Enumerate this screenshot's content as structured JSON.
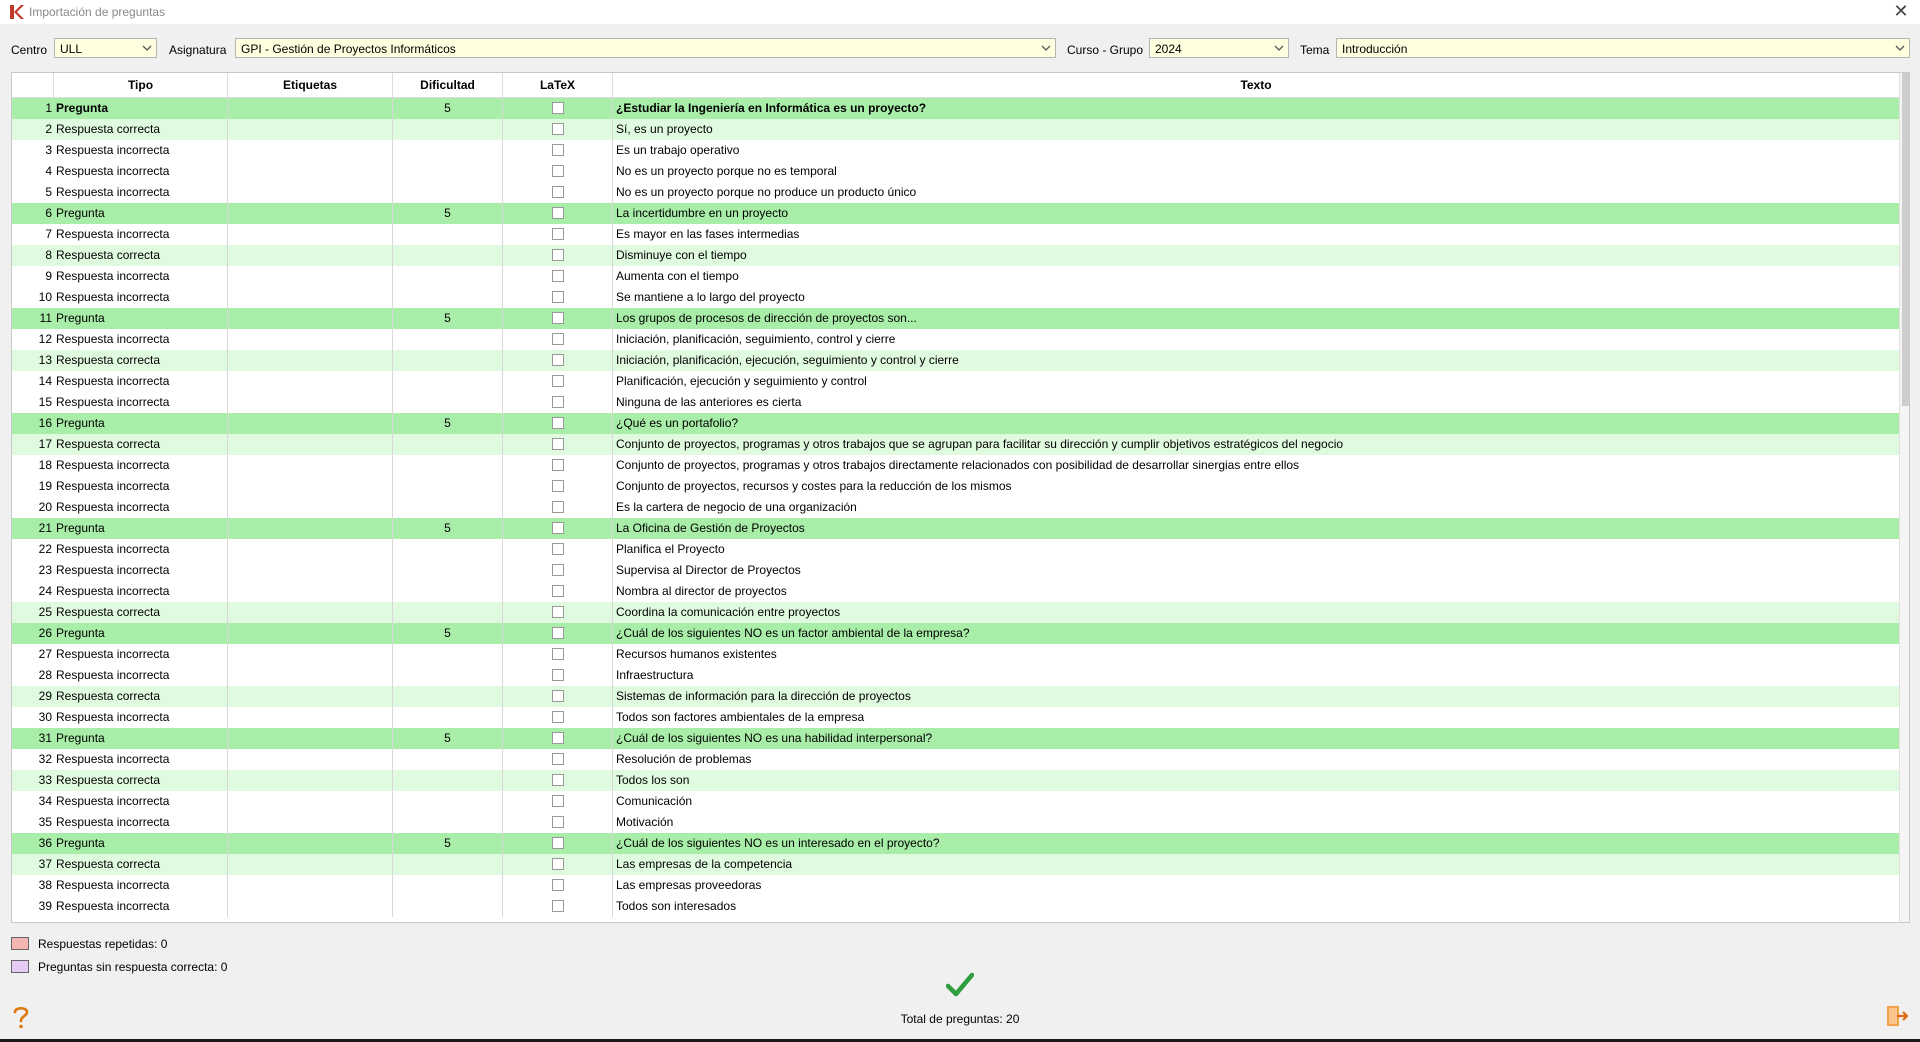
{
  "window": {
    "title": "Importación de preguntas"
  },
  "filters": {
    "centro_label": "Centro",
    "centro_value": "ULL",
    "asignatura_label": "Asignatura",
    "asignatura_value": "GPI - Gestión de Proyectos Informáticos",
    "curso_label": "Curso - Grupo",
    "curso_value": "2024",
    "tema_label": "Tema",
    "tema_value": "Introducción"
  },
  "table": {
    "headers": [
      "Tipo",
      "Etiquetas",
      "Dificultad",
      "LaTeX",
      "Texto"
    ],
    "rows": [
      {
        "n": "1",
        "tipo": "Pregunta",
        "dif": "5",
        "texto": "¿Estudiar la Ingeniería en Informática es un proyecto?",
        "kind": "q"
      },
      {
        "n": "2",
        "tipo": "Respuesta correcta",
        "dif": "",
        "texto": "Sí, es un proyecto",
        "kind": "rc"
      },
      {
        "n": "3",
        "tipo": "Respuesta incorrecta",
        "dif": "",
        "texto": "Es un trabajo operativo",
        "kind": "ri"
      },
      {
        "n": "4",
        "tipo": "Respuesta incorrecta",
        "dif": "",
        "texto": "No es un proyecto porque no es temporal",
        "kind": "ri"
      },
      {
        "n": "5",
        "tipo": "Respuesta incorrecta",
        "dif": "",
        "texto": "No es un proyecto porque no produce un producto único",
        "kind": "ri"
      },
      {
        "n": "6",
        "tipo": "Pregunta",
        "dif": "5",
        "texto": "La incertidumbre en un proyecto",
        "kind": "q"
      },
      {
        "n": "7",
        "tipo": "Respuesta incorrecta",
        "dif": "",
        "texto": "Es mayor en las fases intermedias",
        "kind": "ri"
      },
      {
        "n": "8",
        "tipo": "Respuesta correcta",
        "dif": "",
        "texto": "Disminuye con el tiempo",
        "kind": "rc"
      },
      {
        "n": "9",
        "tipo": "Respuesta incorrecta",
        "dif": "",
        "texto": "Aumenta con el tiempo",
        "kind": "ri"
      },
      {
        "n": "10",
        "tipo": "Respuesta incorrecta",
        "dif": "",
        "texto": "Se mantiene a lo largo del proyecto",
        "kind": "ri"
      },
      {
        "n": "11",
        "tipo": "Pregunta",
        "dif": "5",
        "texto": "Los grupos de procesos de dirección de proyectos son...",
        "kind": "q"
      },
      {
        "n": "12",
        "tipo": "Respuesta incorrecta",
        "dif": "",
        "texto": "Iniciación, planificación, seguimiento, control y cierre",
        "kind": "ri"
      },
      {
        "n": "13",
        "tipo": "Respuesta correcta",
        "dif": "",
        "texto": "Iniciación, planificación, ejecución, seguimiento y control y cierre",
        "kind": "rc"
      },
      {
        "n": "14",
        "tipo": "Respuesta incorrecta",
        "dif": "",
        "texto": "Planificación, ejecución y seguimiento y control",
        "kind": "ri"
      },
      {
        "n": "15",
        "tipo": "Respuesta incorrecta",
        "dif": "",
        "texto": "Ninguna de las anteriores es cierta",
        "kind": "ri"
      },
      {
        "n": "16",
        "tipo": "Pregunta",
        "dif": "5",
        "texto": "¿Qué es un portafolio?",
        "kind": "q"
      },
      {
        "n": "17",
        "tipo": "Respuesta correcta",
        "dif": "",
        "texto": "Conjunto de proyectos, programas y otros trabajos que se agrupan para facilitar su dirección y cumplir objetivos estratégicos del negocio",
        "kind": "rc"
      },
      {
        "n": "18",
        "tipo": "Respuesta incorrecta",
        "dif": "",
        "texto": "Conjunto de proyectos, programas y otros trabajos directamente relacionados con posibilidad de desarrollar sinergias entre ellos",
        "kind": "ri"
      },
      {
        "n": "19",
        "tipo": "Respuesta incorrecta",
        "dif": "",
        "texto": "Conjunto de proyectos, recursos y costes para la reducción de los mismos",
        "kind": "ri"
      },
      {
        "n": "20",
        "tipo": "Respuesta incorrecta",
        "dif": "",
        "texto": "Es la cartera de negocio de una organización",
        "kind": "ri"
      },
      {
        "n": "21",
        "tipo": "Pregunta",
        "dif": "5",
        "texto": "La Oficina de Gestión de Proyectos",
        "kind": "q"
      },
      {
        "n": "22",
        "tipo": "Respuesta incorrecta",
        "dif": "",
        "texto": "Planifica el Proyecto",
        "kind": "ri"
      },
      {
        "n": "23",
        "tipo": "Respuesta incorrecta",
        "dif": "",
        "texto": "Supervisa al Director de Proyectos",
        "kind": "ri"
      },
      {
        "n": "24",
        "tipo": "Respuesta incorrecta",
        "dif": "",
        "texto": "Nombra al director de proyectos",
        "kind": "ri"
      },
      {
        "n": "25",
        "tipo": "Respuesta correcta",
        "dif": "",
        "texto": "Coordina la comunicación entre proyectos",
        "kind": "rc"
      },
      {
        "n": "26",
        "tipo": "Pregunta",
        "dif": "5",
        "texto": "¿Cuál de los siguientes NO es un factor ambiental de la empresa?",
        "kind": "q"
      },
      {
        "n": "27",
        "tipo": "Respuesta incorrecta",
        "dif": "",
        "texto": "Recursos humanos existentes",
        "kind": "ri"
      },
      {
        "n": "28",
        "tipo": "Respuesta incorrecta",
        "dif": "",
        "texto": "Infraestructura",
        "kind": "ri"
      },
      {
        "n": "29",
        "tipo": "Respuesta correcta",
        "dif": "",
        "texto": "Sistemas de información para la dirección de proyectos",
        "kind": "rc"
      },
      {
        "n": "30",
        "tipo": "Respuesta incorrecta",
        "dif": "",
        "texto": "Todos son factores ambientales de la empresa",
        "kind": "ri"
      },
      {
        "n": "31",
        "tipo": "Pregunta",
        "dif": "5",
        "texto": "¿Cuál de los siguientes NO es una habilidad interpersonal?",
        "kind": "q"
      },
      {
        "n": "32",
        "tipo": "Respuesta incorrecta",
        "dif": "",
        "texto": "Resolución de problemas",
        "kind": "ri"
      },
      {
        "n": "33",
        "tipo": "Respuesta correcta",
        "dif": "",
        "texto": "Todos los son",
        "kind": "rc"
      },
      {
        "n": "34",
        "tipo": "Respuesta incorrecta",
        "dif": "",
        "texto": "Comunicación",
        "kind": "ri"
      },
      {
        "n": "35",
        "tipo": "Respuesta incorrecta",
        "dif": "",
        "texto": "Motivación",
        "kind": "ri"
      },
      {
        "n": "36",
        "tipo": "Pregunta",
        "dif": "5",
        "texto": "¿Cuál de los siguientes NO es un interesado en el proyecto?",
        "kind": "q"
      },
      {
        "n": "37",
        "tipo": "Respuesta correcta",
        "dif": "",
        "texto": "Las empresas de la competencia",
        "kind": "rc"
      },
      {
        "n": "38",
        "tipo": "Respuesta incorrecta",
        "dif": "",
        "texto": "Las empresas proveedoras",
        "kind": "ri"
      },
      {
        "n": "39",
        "tipo": "Respuesta incorrecta",
        "dif": "",
        "texto": "Todos son interesados",
        "kind": "ri"
      }
    ]
  },
  "legend": {
    "repeated": "Respuestas repetidas: 0",
    "repeated_color": "#f4b6b2",
    "no_correct": "Preguntas sin respuesta correcta: 0",
    "no_correct_color": "#e6ccf5"
  },
  "footer": {
    "total": "Total de preguntas: 20"
  },
  "icons": {
    "ok": "checkmark-icon",
    "help": "question-mark-icon",
    "exit": "exit-door-icon",
    "close": "close-icon"
  },
  "colors": {
    "question_row": "#a8eda8",
    "correct_row": "#e0fae0",
    "combo_bg": "#ffffe0",
    "accent_orange": "#f08a24",
    "check_green": "#2e9e3e"
  }
}
